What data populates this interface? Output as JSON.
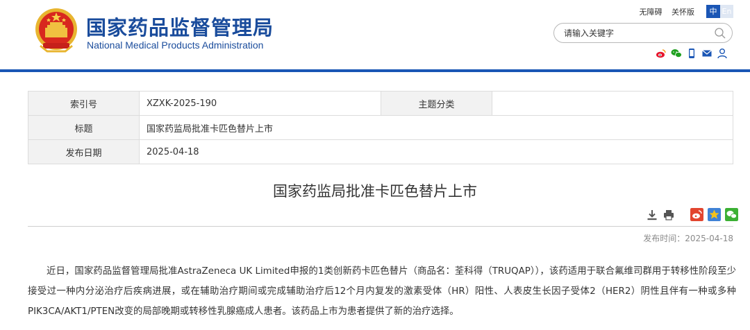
{
  "header": {
    "title_cn": "国家药品监督管理局",
    "title_en": "National Medical Products Administration",
    "links": [
      "无障碍",
      "关怀版"
    ],
    "lang_zh": "中",
    "lang_en": "En",
    "search_placeholder": "请输入关键字",
    "social_icons": [
      "weibo-icon",
      "wechat-icon",
      "mobile-icon",
      "mail-icon",
      "user-icon"
    ],
    "accent_color": "#1a56b5"
  },
  "info": {
    "index_label": "索引号",
    "index_value": "XZXK-2025-190",
    "category_label": "主题分类",
    "category_value": "",
    "title_label": "标题",
    "title_value": "国家药监局批准卡匹色替片上市",
    "date_label": "发布日期",
    "date_value": "2025-04-18"
  },
  "article": {
    "title": "国家药监局批准卡匹色替片上市",
    "tool_icons": [
      "download-icon",
      "print-icon",
      "weibo-share-icon",
      "star-share-icon",
      "wechat-share-icon"
    ],
    "pubtime": "发布时间：2025-04-18",
    "body": "近日，国家药品监督管理局批准AstraZeneca UK Limited申报的1类创新药卡匹色替片（商品名：荃科得（TRUQAP）），该药适用于联合氟维司群用于转移性阶段至少接受过一种内分泌治疗后疾病进展，或在辅助治疗期间或完成辅助治疗后12个月内复发的激素受体（HR）阳性、人表皮生长因子受体2（HER2）阴性且伴有一种或多种PIK3CA/AKT1/PTEN改变的局部晚期或转移性乳腺癌成人患者。该药品上市为患者提供了新的治疗选择。"
  }
}
